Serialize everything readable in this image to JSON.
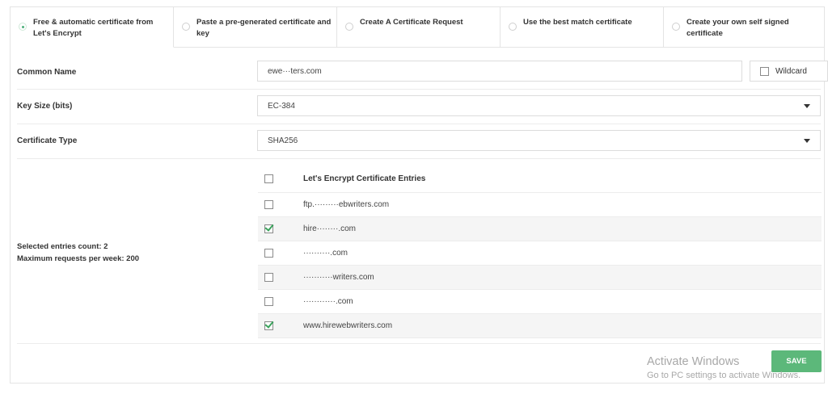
{
  "tabs": [
    {
      "label": "Free & automatic certificate from Let's Encrypt",
      "active": true
    },
    {
      "label": "Paste a pre-generated certificate and key",
      "active": false
    },
    {
      "label": "Create A Certificate Request",
      "active": false
    },
    {
      "label": "Use the best match certificate",
      "active": false
    },
    {
      "label": "Create your own self signed certificate",
      "active": false
    }
  ],
  "form": {
    "common_name": {
      "label": "Common Name",
      "value": "ewe···ters.com",
      "wildcard_label": "Wildcard",
      "wildcard_checked": false
    },
    "key_size": {
      "label": "Key Size (bits)",
      "value": "EC-384"
    },
    "cert_type": {
      "label": "Certificate Type",
      "value": "SHA256"
    }
  },
  "entries": {
    "header": "Let's Encrypt Certificate Entries",
    "header_checked": false,
    "items": [
      {
        "text": "ftp.·········ebwriters.com",
        "checked": false
      },
      {
        "text": "hire········.com",
        "checked": true
      },
      {
        "text": "··········.com",
        "checked": false
      },
      {
        "text": "···········writers.com",
        "checked": false
      },
      {
        "text": "············.com",
        "checked": false
      },
      {
        "text": "www.hirewebwriters.com",
        "checked": true
      }
    ]
  },
  "summary": {
    "selected_count": "Selected entries count: 2",
    "max_requests": "Maximum requests per week: 200"
  },
  "save_label": "SAVE",
  "watermark": {
    "line1": "Activate Windows",
    "line2": "Go to PC settings to activate Windows."
  },
  "colors": {
    "accent": "#5cb87a",
    "check": "#3aa35c"
  }
}
